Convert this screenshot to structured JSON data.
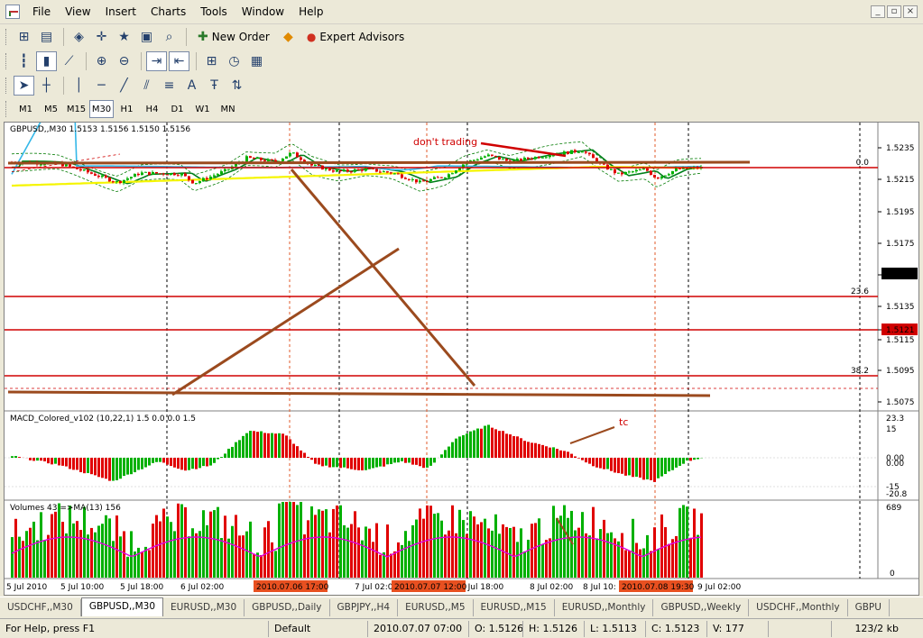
{
  "menubar": {
    "items": [
      "File",
      "View",
      "Insert",
      "Charts",
      "Tools",
      "Window",
      "Help"
    ],
    "window_buttons": [
      "_",
      "▫",
      "×"
    ]
  },
  "toolbar": {
    "new_order_label": "New Order",
    "expert_advisors_label": "Expert Advisors"
  },
  "periods": [
    "M1",
    "M5",
    "M15",
    "M30",
    "H1",
    "H4",
    "D1",
    "W1",
    "MN"
  ],
  "active_period": "M30",
  "chart": {
    "main_title": "GBPUSD,,M30  1.5153 1.5156 1.5150 1.5156",
    "macd_title": "MACD_Colored_v102 (10,22,1) 1.5 0.0 0.0 1.5",
    "volume_title": "Volumes 43  =>MA(13) 156",
    "price_axis": [
      "1.5235",
      "1.5215",
      "1.5195",
      "1.5175",
      "1.5156",
      "1.5135",
      "1.5121",
      "1.5115",
      "1.5095",
      "1.5075"
    ],
    "current_price_tag": "1.5156",
    "line_price_tag": "1.5121",
    "fib_labels": [
      "0.0",
      "23.6",
      "38.2"
    ],
    "macd_axis": [
      "23.3",
      "15",
      "0.00",
      "0.00",
      "-15",
      "-20.8"
    ],
    "volume_axis": [
      "689",
      "0"
    ],
    "annotations": [
      "don't trading",
      "tc"
    ],
    "time_labels": [
      "5 Jul 2010",
      "5 Jul 10:00",
      "5 Jul 18:00",
      "6 Jul 02:00",
      "7 Jul 02:00",
      "7 Jul 18:00",
      "8 Jul 02:00",
      "8 Jul 10:",
      "9 Jul 02:00"
    ],
    "time_tags": [
      "2010.07.06 17:00",
      "2010.07.07 12:00",
      "2010.07.08 19:30"
    ],
    "colors": {
      "bull": "#00b000",
      "bear": "#e00000",
      "support": "#9b4a1e",
      "fib": "#d00000",
      "ma_yellow": "#f5f500",
      "ma_blue": "#33b7e8",
      "ma_green": "#00801a",
      "volume_ma": "#e000e0",
      "price_tag_bg": "#000000",
      "time_tag_bg": "#e85020"
    }
  },
  "tabs": [
    "USDCHF,,M30",
    "GBPUSD,,M30",
    "EURUSD,,M30",
    "GBPUSD,,Daily",
    "GBPJPY,,H4",
    "EURUSD,,M5",
    "EURUSD,,M15",
    "EURUSD,,Monthly",
    "GBPUSD,,Weekly",
    "USDCHF,,Monthly",
    "GBPU"
  ],
  "active_tab": "GBPUSD,,M30",
  "status": {
    "help": "For Help, press F1",
    "profile": "Default",
    "datetime": "2010.07.07 07:00",
    "open": "O: 1.5126",
    "high": "H: 1.5126",
    "low": "L: 1.5113",
    "close": "C: 1.5123",
    "volume": "V: 177",
    "traffic": "123/2 kb"
  }
}
